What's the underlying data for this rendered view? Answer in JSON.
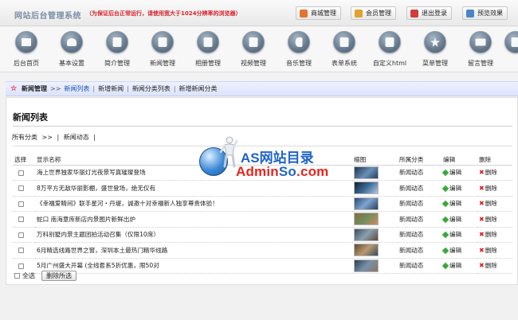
{
  "header": {
    "system_title": "网站后台管理系统",
    "notice": "（为保证后台正常运行，请使用宽大于1024分辨率的浏览器）",
    "buttons": [
      {
        "label": "商城管理",
        "color": "#e3752f"
      },
      {
        "label": "会员管理",
        "color": "#e3a12f"
      },
      {
        "label": "退出登录",
        "color": "#d33b3b"
      },
      {
        "label": "预览效果",
        "color": "#4a86c5"
      }
    ]
  },
  "nav": [
    {
      "label": "后台首页",
      "icon": "home-icon"
    },
    {
      "label": "基本设置",
      "icon": "heart-icon"
    },
    {
      "label": "简介管理",
      "icon": "document-icon"
    },
    {
      "label": "新闻管理",
      "icon": "document-icon"
    },
    {
      "label": "相册管理",
      "icon": "document-icon"
    },
    {
      "label": "视频管理",
      "icon": "document-icon"
    },
    {
      "label": "音乐管理",
      "icon": "music-icon"
    },
    {
      "label": "表单系统",
      "icon": "document-icon"
    },
    {
      "label": "自定义html",
      "icon": "document-icon"
    },
    {
      "label": "菜单管理",
      "icon": "star-icon"
    },
    {
      "label": "留言管理",
      "icon": "mail-icon"
    }
  ],
  "breadcrumb": {
    "current": "新闻管理",
    "separator": ">>",
    "items": [
      "新闻列表",
      "新增新闻",
      "新闻分类列表",
      "新增新闻分类"
    ]
  },
  "page": {
    "title": "新闻列表",
    "filter": {
      "all": "所有分类",
      "sep": ">>",
      "current": "新闻动态",
      "bar": "|"
    }
  },
  "table": {
    "headers": [
      "选择",
      "显示名称",
      "缩图",
      "所属分类",
      "编辑",
      "删除"
    ],
    "edit_label": "编辑",
    "delete_label": "删除",
    "rows": [
      {
        "title": "海上世界独家华丽灯光夜景写真璀璨登场",
        "category": "新闻动态",
        "thumb_color": "#3b5e86"
      },
      {
        "title": "8万平方无敌华丽影棚，盛世登场，绝无仅有",
        "category": "新闻动态",
        "thumb_color": "#2f4a6a"
      },
      {
        "title": "《幸福爱睛间》联手星河・丹堤，诚邀十对幸福新人独享尊贵体验！",
        "category": "新闻动态",
        "thumb_color": "#34587e"
      },
      {
        "title": "蛇口 南海意库新店内景图片新鲜出炉",
        "category": "新闻动态",
        "thumb_color": "#6f8b5a"
      },
      {
        "title": "万科别墅内景主题团拍活动召集（仅限10席）",
        "category": "新闻动态",
        "thumb_color": "#5a6f7d"
      },
      {
        "title": "6月精选线路世界之窗，深圳本土最热门精华线路",
        "category": "新闻动态",
        "thumb_color": "#7a6a4e"
      },
      {
        "title": "5月广州盛大开幕 (全线套系5折优惠，限50对",
        "category": "新闻动态",
        "thumb_color": "#4d5f72"
      }
    ]
  },
  "footer": {
    "select_all": "全选",
    "delete_selected": "删除所选"
  },
  "watermark": {
    "line1": "AS网站目录",
    "line2_a": "Admin",
    "line2_b": "So",
    "line2_c": ".com"
  }
}
